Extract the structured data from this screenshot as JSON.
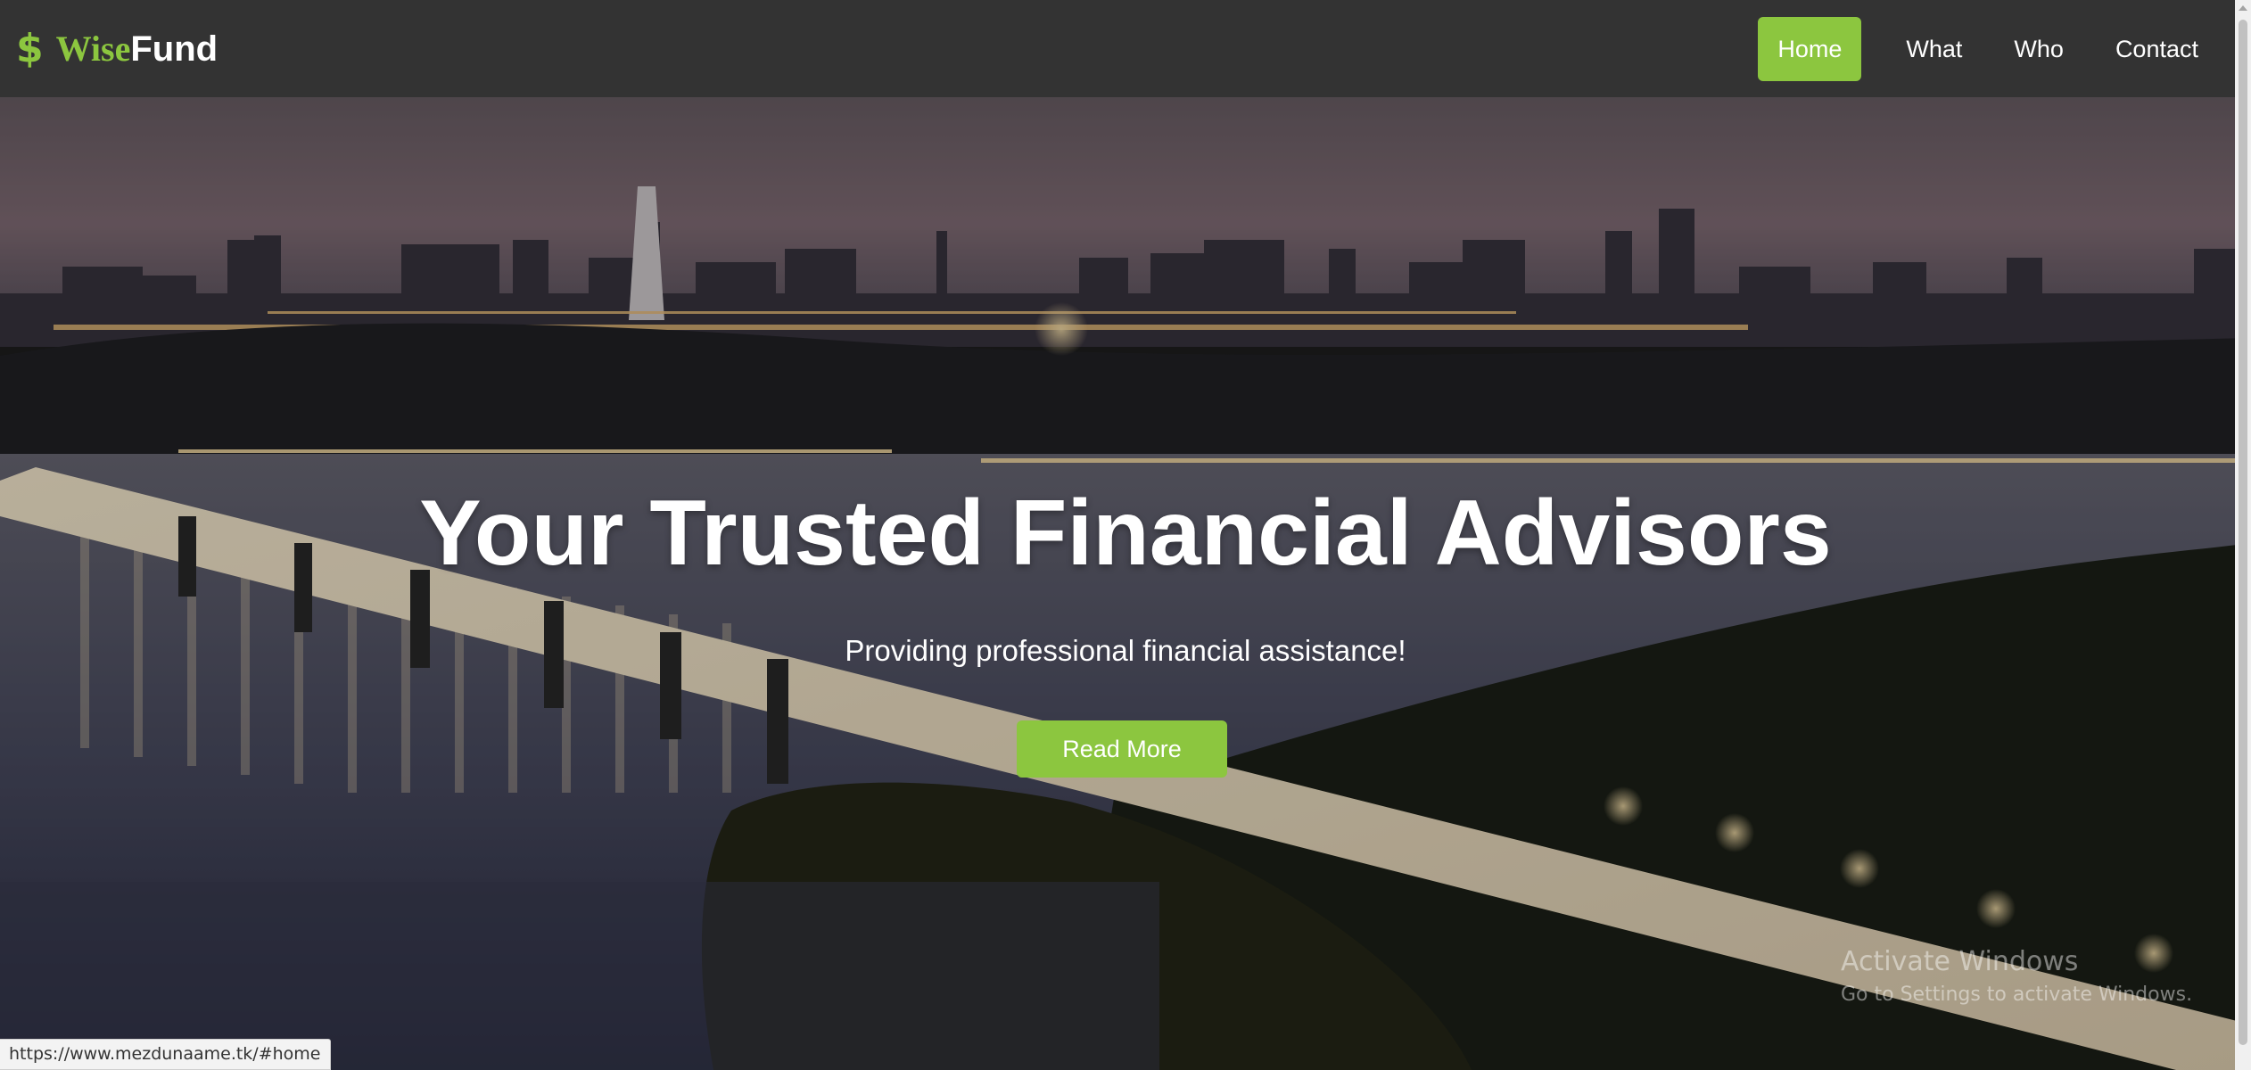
{
  "brand": {
    "icon": "dollar-sign-icon",
    "symbol": "$",
    "name_part1": "Wise",
    "name_part2": "Fund"
  },
  "nav": {
    "items": [
      {
        "label": "Home",
        "active": true
      },
      {
        "label": "What",
        "active": false
      },
      {
        "label": "Who",
        "active": false
      },
      {
        "label": "Contact",
        "active": false
      }
    ]
  },
  "hero": {
    "title": "Your Trusted Financial Advisors",
    "subtitle": "Providing professional financial assistance!",
    "button_label": "Read More",
    "background": "night-city-bridge-river-photo"
  },
  "watermark": {
    "title": "Activate Windows",
    "subtitle": "Go to Settings to activate Windows."
  },
  "status_bar": {
    "url": "https://www.mezdunaame.tk/#home"
  },
  "colors": {
    "accent": "#8cc63f",
    "navbar": "#333333",
    "text_light": "#ffffff"
  }
}
